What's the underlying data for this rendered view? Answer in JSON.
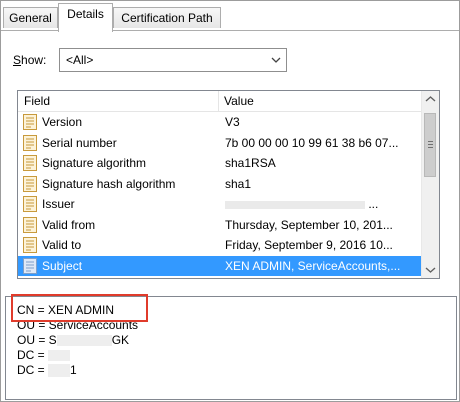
{
  "tabs": [
    {
      "label": "General"
    },
    {
      "label": "Details"
    },
    {
      "label": "Certification Path"
    }
  ],
  "show": {
    "label_first": "S",
    "label_rest": "how:",
    "selected": "<All>"
  },
  "list": {
    "headers": {
      "field": "Field",
      "value": "Value"
    },
    "rows": [
      {
        "field": "Version",
        "value": "V3"
      },
      {
        "field": "Serial number",
        "value": "7b 00 00 00 10 99 61 38 b6 07..."
      },
      {
        "field": "Signature algorithm",
        "value": "sha1RSA"
      },
      {
        "field": "Signature hash algorithm",
        "value": "sha1"
      },
      {
        "field": "Issuer",
        "value": "..."
      },
      {
        "field": "Valid from",
        "value": "Thursday, September 10, 201..."
      },
      {
        "field": "Valid to",
        "value": "Friday, September 9, 2016 10..."
      },
      {
        "field": "Subject",
        "value": "XEN ADMIN, ServiceAccounts,..."
      }
    ]
  },
  "detail": {
    "lines": [
      "CN = XEN ADMIN",
      "OU = ServiceAccounts",
      "OU = S",
      "DC =",
      "DC ="
    ],
    "line3_suffix": "GK",
    "line5_suffix": "1"
  },
  "colors": {
    "selection": "#3399ff",
    "annotation": "#e03b2b"
  }
}
